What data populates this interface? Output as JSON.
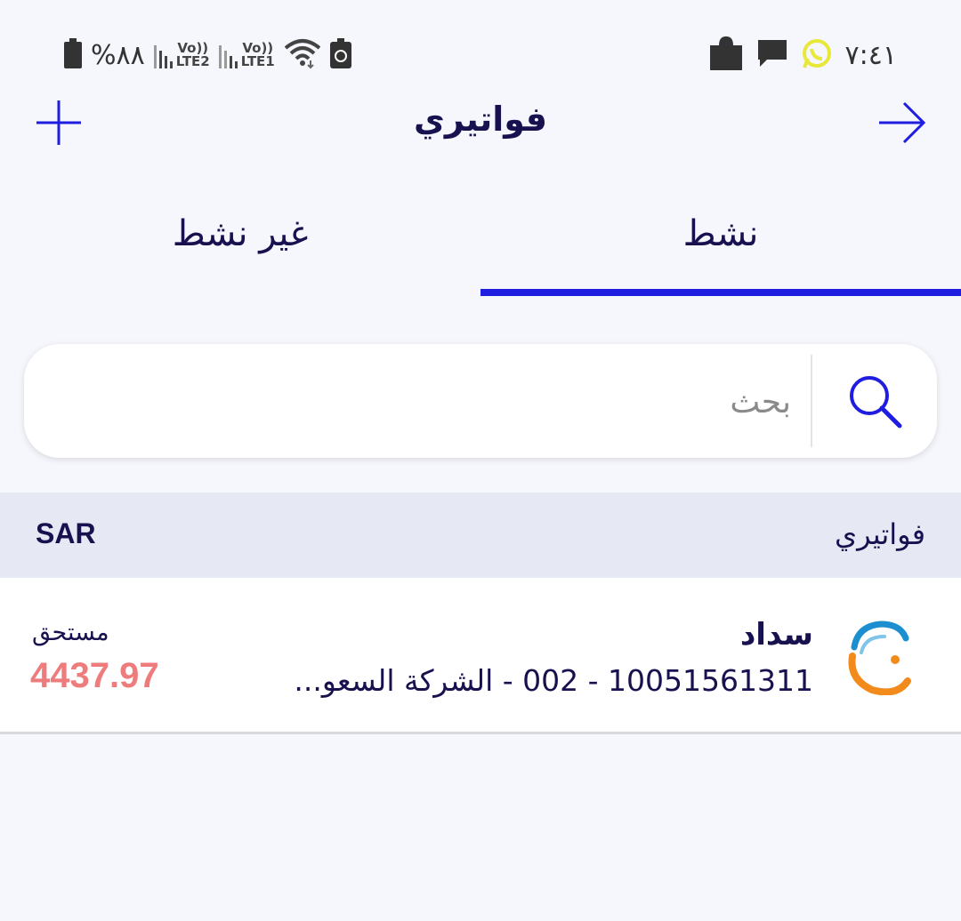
{
  "status_bar": {
    "battery_text": "%٨٨",
    "sim2_label": "LTE2",
    "sim1_label": "LTE1",
    "volte_label": "Vo))",
    "time": "٧:٤١",
    "icons": [
      "battery-icon",
      "signal-icon",
      "wifi-icon",
      "battery-saver-icon",
      "puzzle-icon",
      "message-icon",
      "whatsapp-icon"
    ]
  },
  "header": {
    "title": "فواتيري",
    "add_icon": "plus-icon",
    "back_icon": "arrow-right-icon"
  },
  "tabs": [
    {
      "label": "نشط",
      "active": true
    },
    {
      "label": "غير نشط",
      "active": false
    }
  ],
  "search": {
    "placeholder": "بحث",
    "value": ""
  },
  "section": {
    "title": "فواتيري",
    "currency": "SAR"
  },
  "bills": [
    {
      "name": "سداد",
      "subtitle": "10051561311  - 002 - الشركة السعو...",
      "due_label": "مستحق",
      "amount": "4437.97"
    }
  ],
  "colors": {
    "accent": "#1f1de0",
    "text": "#17124f",
    "amount": "#ef7c7c",
    "background": "#f6f7fd",
    "section_bg": "#e6e9f4"
  }
}
